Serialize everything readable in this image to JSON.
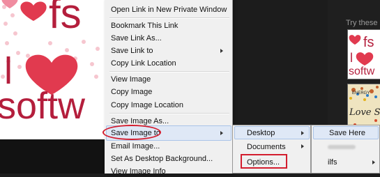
{
  "right_panel": {
    "heading": "Try these"
  },
  "logo": {
    "text_top": "fs",
    "text_mid": "l",
    "text_bottom": "softw"
  },
  "thumbnail1": {
    "line1": "fs",
    "line2": "l",
    "line3": "softw"
  },
  "thumbnail2": {
    "line1": "ENERGY",
    "line2": "Love S"
  },
  "context_menu": {
    "items": [
      {
        "label": "Open Link in New Private Window",
        "has_submenu": false
      },
      {
        "label": "Bookmark This Link",
        "has_submenu": false
      },
      {
        "label": "Save Link As...",
        "has_submenu": false
      },
      {
        "label": "Save Link to",
        "has_submenu": true
      },
      {
        "label": "Copy Link Location",
        "has_submenu": false
      },
      {
        "label": "View Image",
        "has_submenu": false
      },
      {
        "label": "Copy Image",
        "has_submenu": false
      },
      {
        "label": "Copy Image Location",
        "has_submenu": false
      },
      {
        "label": "Save Image As...",
        "has_submenu": false
      },
      {
        "label": "Save Image to",
        "has_submenu": true,
        "highlighted": true
      },
      {
        "label": "Email Image...",
        "has_submenu": false
      },
      {
        "label": "Set As Desktop Background...",
        "has_submenu": false
      },
      {
        "label": "View Image Info",
        "has_submenu": false
      }
    ]
  },
  "submenu_save_image_to": {
    "items": [
      {
        "label": "Desktop",
        "has_submenu": true,
        "highlighted": true
      },
      {
        "label": "Documents",
        "has_submenu": true
      },
      {
        "label": "Options...",
        "has_submenu": false
      }
    ]
  },
  "submenu_desktop": {
    "items": [
      {
        "label": "Save Here",
        "highlighted": true
      },
      {
        "label": "",
        "blurred": true
      },
      {
        "label": "ilfs",
        "has_submenu": true
      }
    ]
  },
  "colors": {
    "annotation_red": "#d31d2e",
    "logo_red": "#e13a4f",
    "menu_bg": "#f0f0f0",
    "highlight": "#dfe8f6"
  }
}
